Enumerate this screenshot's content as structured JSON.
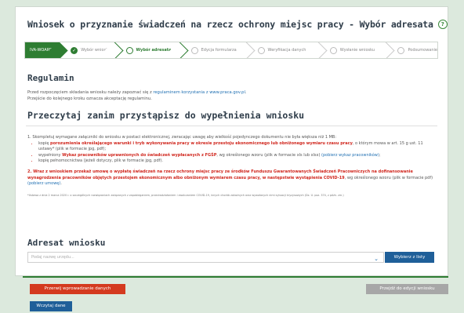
{
  "header": {
    "title": "Wniosek o przyznanie świadczeń na rzecz ochrony miejsc pracy - Wybór adresata",
    "help_icon": "question-circle-icon"
  },
  "stepper": {
    "steps": [
      {
        "label": "IVA-WOARP",
        "state": "first"
      },
      {
        "label": "Wybór wniosku",
        "state": "done"
      },
      {
        "label": "Wybór adresata",
        "state": "active"
      },
      {
        "label": "Edycja formularza",
        "state": "todo"
      },
      {
        "label": "Weryfikacja danych",
        "state": "todo"
      },
      {
        "label": "Wysłanie wniosku",
        "state": "todo"
      },
      {
        "label": "Podsumowanie",
        "state": "todo"
      }
    ]
  },
  "regulamin": {
    "heading": "Regulamin",
    "line1_prefix": "Przed rozpoczęciem składania wniosku należy zapoznać się z ",
    "line1_link": "regulaminem korzystania z www.praca.gov.pl",
    "line1_suffix": ".",
    "line2": "Przejście do kolejnego kroku oznacza akceptację regulaminu."
  },
  "read_before": {
    "heading": "Przeczytaj zanim przystąpisz do wypełnienia wniosku",
    "intro": "1. Skompletuj wymagane załączniki do wniosku w postaci elektronicznej, zwracając uwagę aby wielkość pojedynczego dokumentu nie była większa niż 1 MB:",
    "b1_prefix": "kopię ",
    "b1_red": "porozumienia określającego warunki i tryb wykonywania pracy w okresie przestoju ekonomicznego lub obniżonego wymiaru czasu pracy",
    "b1_suffix": ", o którym mowa w art. 15 g ust. 11 ustawy* (plik w formacie jpg, pdf);",
    "b2_prefix": "wypełniony ",
    "b2_red": "Wykaz pracowników uprawnionych do świadczeń wypłacanych z FGŚP",
    "b2_suffix": ", wg określonego wzoru (plik w formacie xls lub xlsx) ",
    "b2_link": "(pobierz wykaz pracowników)",
    "b2_end": ";",
    "b3": "kopię pełnomocnictwa (jeżeli dotyczy, plik w formacie jpg, pdf).",
    "p2_red": "2. Wraz z wnioskiem przekaż umowę o wypłatę świadczeń na rzecz ochrony miejsc pracy ze środków Funduszu Gwarantowanych Świadczeń Pracowniczych na dofinansowanie wynagrodzenia pracowników objętych przestojem ekonomicznym albo obniżonym wymiarem czasu pracy, w następstwie wystąpienia COVID-19",
    "p2_suffix": ", wg określonego wzoru (plik w formacie pdf) ",
    "p2_link": "(pobierz umowę)",
    "p2_end": ".",
    "footnote": "*Ustawa z dnia 2 marca 2020 r. o szczególnych rozwiązaniach związanych z zapobieganiem, przeciwdziałaniem i zwalczaniem COVID-19, innych chorób zakaźnych oraz wywołanych nimi sytuacji kryzysowych (Dz. U. poz. 374, z późn. zm.)"
  },
  "addressee": {
    "heading": "Adresat wniosku",
    "placeholder": "Podaj nazwę urzędu...",
    "choose_button": "Wybierz z listy"
  },
  "footer": {
    "cancel_button": "Przerwij wprowadzanie danych",
    "next_button": "Przejdź do edycji wniosku",
    "load_button": "Wczytaj dane"
  }
}
